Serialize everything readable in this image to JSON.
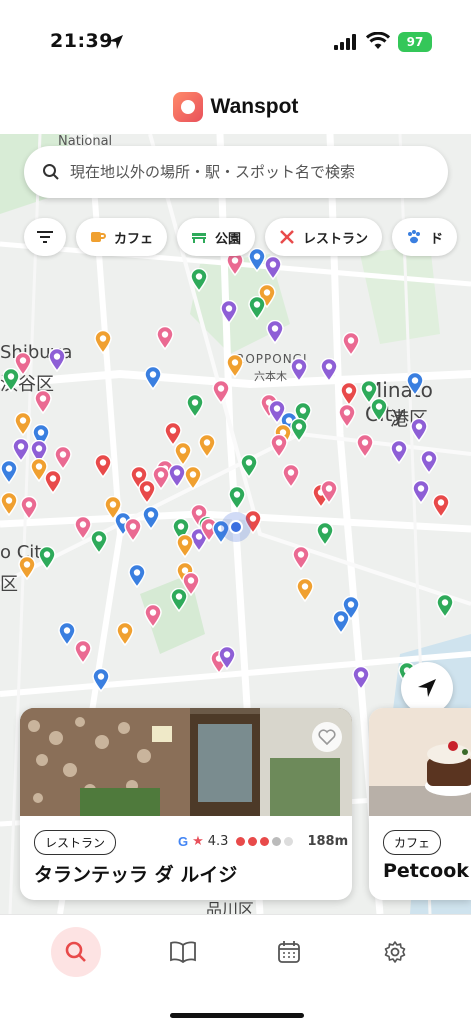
{
  "status_bar": {
    "time": "21:39",
    "battery": "97"
  },
  "app": {
    "title": "Wanspot"
  },
  "search": {
    "placeholder": "現在地以外の場所・駅・スポット名で検索"
  },
  "filters": [
    {
      "label": "カフェ",
      "icon": "coffee-cup-icon",
      "color": "#f0a030"
    },
    {
      "label": "公園",
      "icon": "park-bench-icon",
      "color": "#2eaa5a"
    },
    {
      "label": "レストラン",
      "icon": "fork-knife-icon",
      "color": "#e84a4a"
    },
    {
      "label": "ド",
      "icon": "paw-icon",
      "color": "#3a7fe0"
    }
  ],
  "map_labels": {
    "national": "National",
    "shibuya_en": "Shibuya",
    "shibuya_ja": "渋谷区",
    "roppongi_en": "ROPPONGI",
    "roppongi_ja": "六本木",
    "minato_en": "Minato City",
    "minato_ja": "港区",
    "city_left": "o City",
    "ku_left": "区",
    "shinagawa": "品川区"
  },
  "pin_colors": {
    "cafe": "#f0a030",
    "park": "#2eaa5a",
    "restaurant": "#e84a4a",
    "dog": "#3a7fe0",
    "shop": "#8e5fd6",
    "other": "#ea6a92"
  },
  "cards": [
    {
      "category": "レストラン",
      "name": "タランテッラ ダ ルイジ",
      "rating": "4.3",
      "distance": "188m"
    },
    {
      "category": "カフェ",
      "name": "Petcook"
    }
  ],
  "tabs": [
    {
      "name": "search",
      "icon": "search-icon"
    },
    {
      "name": "book",
      "icon": "book-icon"
    },
    {
      "name": "calendar",
      "icon": "calendar-icon"
    },
    {
      "name": "settings",
      "icon": "gear-icon"
    }
  ]
}
